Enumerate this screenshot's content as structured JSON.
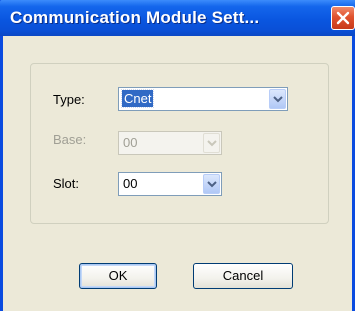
{
  "dialog": {
    "title": "Communication Module Sett...",
    "close_label": "close"
  },
  "form": {
    "type_label": "Type:",
    "type_value": "Cnet",
    "base_label": "Base:",
    "base_value": "00",
    "slot_label": "Slot:",
    "slot_value": "00"
  },
  "buttons": {
    "ok_label": "OK",
    "cancel_label": "Cancel"
  },
  "colors": {
    "titlebar": "#0a56e0",
    "close": "#e0522e",
    "dialog_bg": "#ece9d8",
    "selection": "#316ac5"
  }
}
